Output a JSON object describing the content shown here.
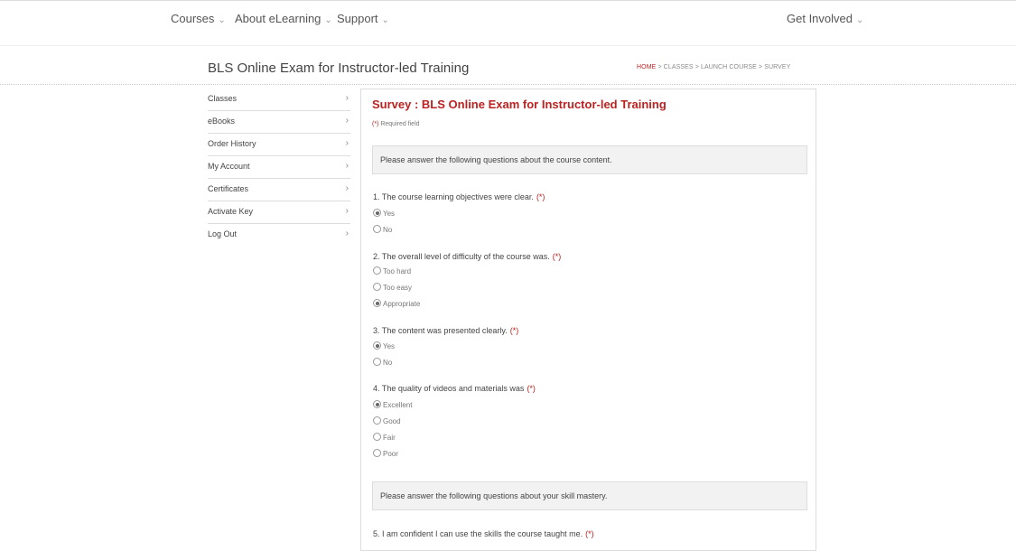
{
  "nav": {
    "courses": "Courses",
    "about": "About eLearning",
    "support": "Support",
    "get_involved": "Get Involved",
    "chevron": "⌄"
  },
  "page": {
    "title": "BLS Online Exam for Instructor-led Training",
    "breadcrumb_home": "HOME",
    "breadcrumb_rest": " > CLASSES > LAUNCH COURSE > SURVEY"
  },
  "sidebar": {
    "items": [
      {
        "label": "Classes"
      },
      {
        "label": "eBooks"
      },
      {
        "label": "Order History"
      },
      {
        "label": "My Account"
      },
      {
        "label": "Certificates"
      },
      {
        "label": "Activate Key"
      },
      {
        "label": "Log Out"
      }
    ],
    "arrow": "›"
  },
  "survey": {
    "title": "Survey : BLS Online Exam for Instructor-led Training",
    "required_marker": "(*)",
    "required_text": " Required field",
    "section1": "Please answer the following questions about the course content.",
    "section2": "Please answer the following questions about your skill mastery.",
    "star": "(*)",
    "questions": [
      {
        "text": "1. The course learning objectives were clear.",
        "options": [
          "Yes",
          "No"
        ],
        "selected": 0
      },
      {
        "text": "2. The overall level of difficulty of the course was.",
        "options": [
          "Too hard",
          "Too easy",
          "Appropriate"
        ],
        "selected": 2
      },
      {
        "text": "3. The content was presented clearly.",
        "options": [
          "Yes",
          "No"
        ],
        "selected": 0
      },
      {
        "text": "4. The quality of videos and materials was",
        "options": [
          "Excellent",
          "Good",
          "Fair",
          "Poor"
        ],
        "selected": 0
      },
      {
        "text": "5. I am confident I can use the skills the course taught me."
      }
    ]
  },
  "colors": {
    "accent": "#bb2222",
    "section_bg": "#f2f2f2"
  }
}
